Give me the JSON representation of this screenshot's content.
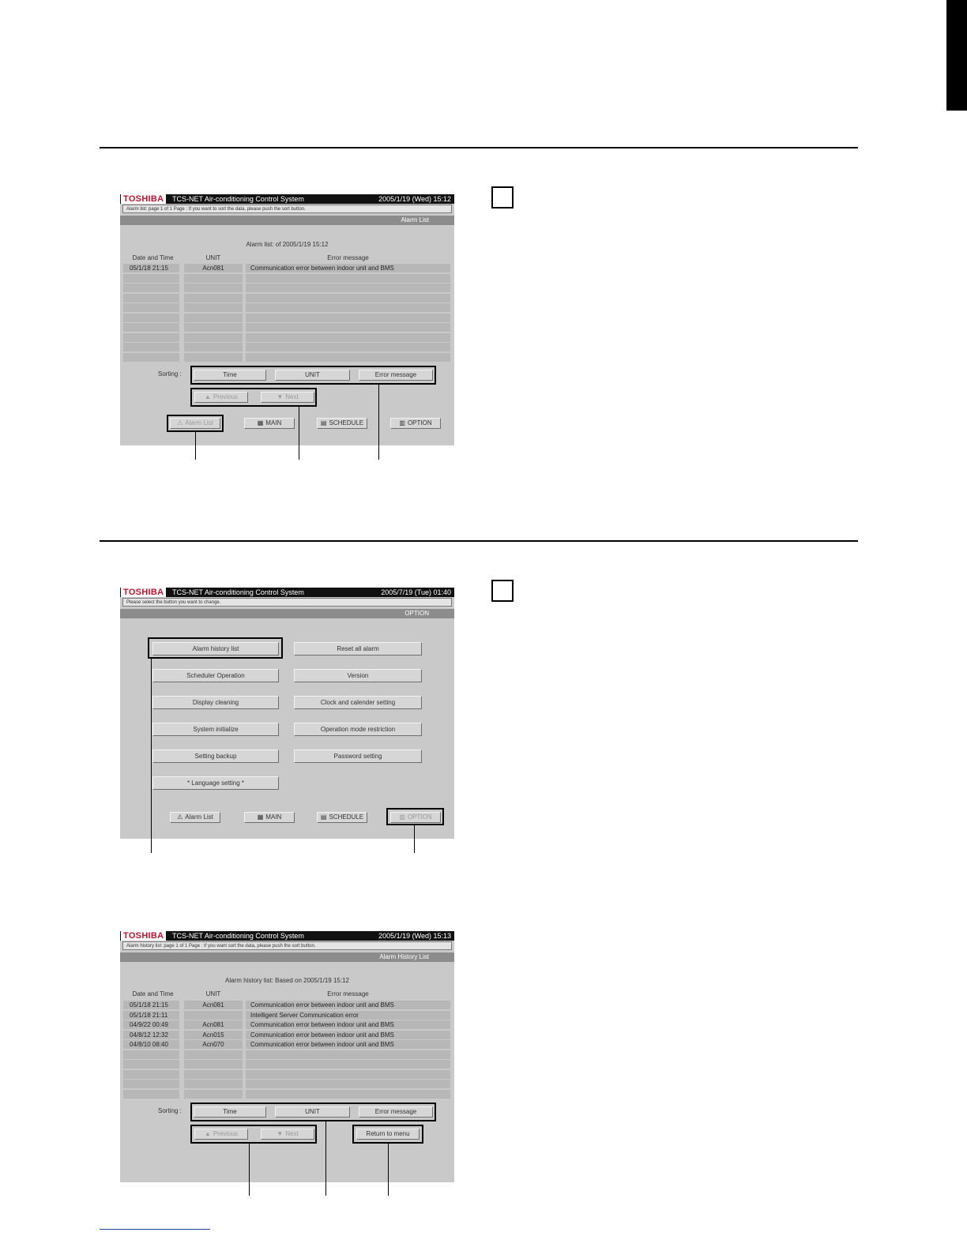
{
  "screen1": {
    "brand": "TOSHIBA",
    "system": "TCS-NET Air-conditioning Control System",
    "datetime": "2005/1/19 (Wed)  15:12",
    "message": "Alarm list: page  1 of 1  Page :  If you want to sort the data, please push the sort button.",
    "screen_name": "Alarm List",
    "caption": "Alarm list: of  2005/1/19 15:12",
    "col_date": "Date and Time",
    "col_unit": "UNIT",
    "col_error": "Error message",
    "rows": [
      {
        "date": "05/1/18 21:15",
        "unit": "Acn081",
        "error": "Communication error between indoor unit and BMS"
      }
    ],
    "sorting_label": "Sorting :",
    "sort_time": "Time",
    "sort_unit": "UNIT",
    "sort_error": "Error message",
    "prev": "Previous",
    "next": "Next",
    "nav_alarm": "Alarm List",
    "nav_main": "MAIN",
    "nav_schedule": "SCHEDULE",
    "nav_option": "OPTION"
  },
  "screen2": {
    "brand": "TOSHIBA",
    "system": "TCS-NET Air-conditioning Control System",
    "datetime": "2005/7/19 (Tue)  01:40",
    "message": "Please select the button you want to change.",
    "screen_name": "OPTION",
    "left_buttons": [
      "Alarm history list",
      "Scheduler Operation",
      "Display cleaning",
      "System initialize",
      "Setting backup",
      "* Language setting *"
    ],
    "right_buttons": [
      "Reset all alarm",
      "Version",
      "Clock and calender setting",
      "Operation mode restriction",
      "Password setting"
    ],
    "nav_alarm": "Alarm List",
    "nav_main": "MAIN",
    "nav_schedule": "SCHEDULE",
    "nav_option": "OPTION"
  },
  "screen3": {
    "brand": "TOSHIBA",
    "system": "TCS-NET Air-conditioning Control System",
    "datetime": "2005/1/19 (Wed)  15:13",
    "message": "Alarm history list: page  1 of 1  Page : If you want sort the data, please push the sort button.",
    "screen_name": "Alarm History List",
    "caption": "Alarm history list: Based on 2005/1/19 15:12",
    "col_date": "Date and Time",
    "col_unit": "UNIT",
    "col_error": "Error message",
    "rows": [
      {
        "date": "05/1/18 21:15",
        "unit": "Acn081",
        "error": "Communication error between indoor unit and BMS"
      },
      {
        "date": "05/1/18 21:11",
        "unit": "",
        "error": "Intelligent Server Communication error"
      },
      {
        "date": "04/9/22 00:49",
        "unit": "Acn081",
        "error": "Communication error between indoor unit and BMS"
      },
      {
        "date": "04/8/12 12:32",
        "unit": "Acn015",
        "error": "Communication error between indoor unit and BMS"
      },
      {
        "date": "04/8/10 08:40",
        "unit": "Acn070",
        "error": "Communication error between indoor unit and BMS"
      }
    ],
    "sorting_label": "Sorting :",
    "sort_time": "Time",
    "sort_unit": "UNIT",
    "sort_error": "Error message",
    "prev": "Previous",
    "next": "Next",
    "return": "Return to menu"
  }
}
